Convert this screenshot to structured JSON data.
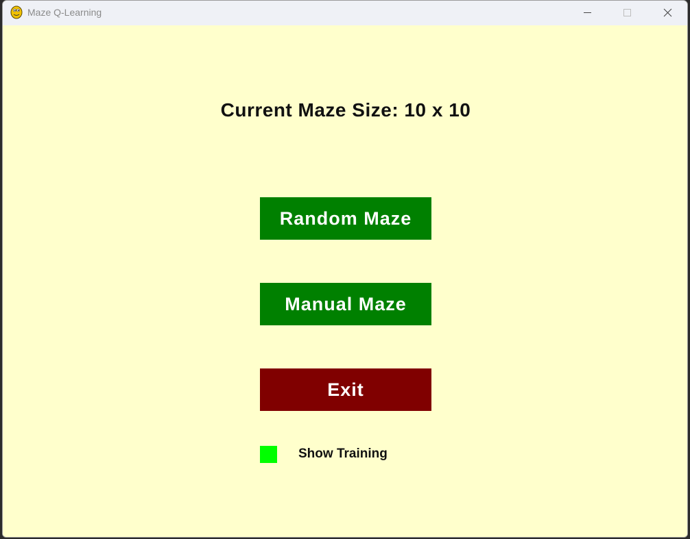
{
  "window": {
    "title": "Maze Q-Learning",
    "app_icon": "python-snake-icon",
    "controls": {
      "minimize_icon": "minimize-icon",
      "maximize_icon": "maximize-icon",
      "close_icon": "close-icon"
    }
  },
  "menu": {
    "heading": "Current Maze Size: 10 x 10",
    "buttons": {
      "random": "Random Maze",
      "manual": "Manual Maze",
      "exit": "Exit"
    },
    "show_training": {
      "label": "Show Training",
      "checked": true
    }
  },
  "colors": {
    "background": "#ffffcc",
    "button_green": "#008000",
    "button_exit": "#800000",
    "toggle_on": "#00ff00"
  }
}
